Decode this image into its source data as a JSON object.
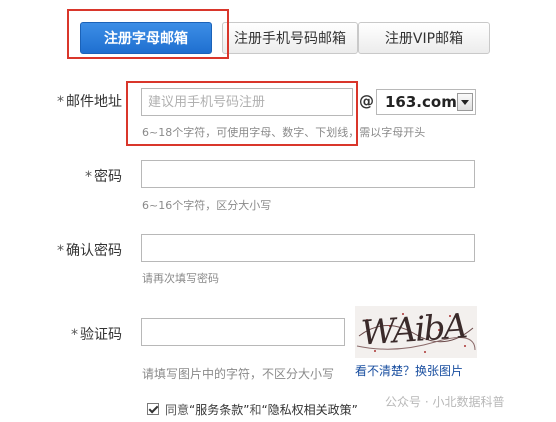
{
  "tabs": [
    {
      "label": "注册字母邮箱",
      "active": true
    },
    {
      "label": "注册手机号码邮箱",
      "active": false
    },
    {
      "label": "注册VIP邮箱",
      "active": false
    }
  ],
  "form": {
    "required_mark": "*",
    "email": {
      "label": "邮件地址",
      "placeholder": "建议用手机号码注册",
      "at": "@",
      "domain": "163.com",
      "hint": "6~18个字符，可使用字母、数字、下划线，需以字母开头"
    },
    "password": {
      "label": "密码",
      "hint": "6~16个字符，区分大小写"
    },
    "confirm_password": {
      "label": "确认密码",
      "hint": "请再次填写密码"
    },
    "captcha": {
      "label": "验证码",
      "hint": "请填写图片中的字符，不区分大小写",
      "image_text": "WAibA",
      "refresh_link": "看不清楚？换张图片"
    },
    "agreement": {
      "prefix": "同意",
      "terms": "“服务条款”",
      "and": "和",
      "privacy": "“隐私权相关政策”",
      "checked": true
    }
  },
  "watermark": "公众号 · 小北数据科普",
  "colors": {
    "active_tab": "#2a7ed8",
    "highlight_border": "#d9362b",
    "link": "#1a4fa0"
  }
}
